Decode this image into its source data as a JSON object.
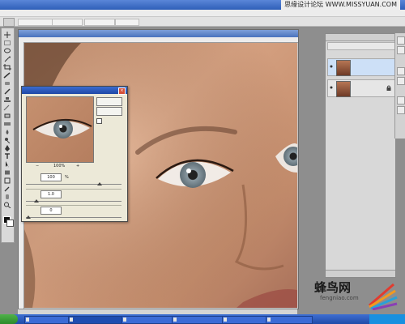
{
  "watermark_top": "思缘设计论坛  WWW.MISSYUAN.COM",
  "watermark_bottom": {
    "name": "蜂鸟网",
    "url": "fengniao.com"
  },
  "options_bar": {
    "items": [
      "",
      "",
      "",
      ""
    ]
  },
  "dialog": {
    "zoom_minus": "−",
    "zoom_value": "100%",
    "zoom_plus": "+",
    "row1": {
      "value": "100",
      "unit": "%"
    },
    "row2": {
      "value": "1.0",
      "unit": ""
    },
    "row3": {
      "value": "0",
      "unit": ""
    }
  },
  "layers": [
    {
      "name": ""
    },
    {
      "name": ""
    }
  ],
  "colors": {
    "skin": "#c79373",
    "iris": "#7f8e96",
    "taskbar": "#245edc"
  }
}
